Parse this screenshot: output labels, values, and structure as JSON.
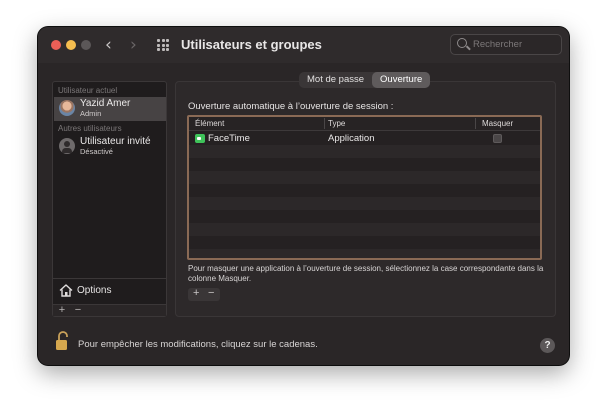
{
  "window": {
    "title": "Utilisateurs et groupes",
    "back_glyph": "‹",
    "forward_glyph": "›",
    "search_placeholder": "Rechercher"
  },
  "sidebar": {
    "current_section": "Utilisateur actuel",
    "current_user": {
      "name": "Yazid Amer",
      "role": "Admin"
    },
    "other_section": "Autres utilisateurs",
    "guest_user": {
      "name": "Utilisateur invité",
      "status": "Désactivé"
    },
    "options_label": "Options",
    "add_glyph": "+",
    "remove_glyph": "−"
  },
  "tabs": [
    {
      "label": "Mot de passe",
      "active": false
    },
    {
      "label": "Ouverture",
      "active": true
    }
  ],
  "login_items": {
    "heading": "Ouverture automatique à l’ouverture de session :",
    "columns": [
      "Élément",
      "Type",
      "Masquer"
    ],
    "rows": [
      {
        "element": "FaceTime",
        "type": "Application",
        "hide": false,
        "icon": "facetime-icon"
      }
    ],
    "help_text": "Pour masquer une application à l’ouverture de session, sélectionnez la case correspondante dans la colonne Masquer.",
    "add_glyph": "+",
    "remove_glyph": "−"
  },
  "footer": {
    "lock_text": "Pour empêcher les modifications, cliquez sur le cadenas.",
    "help_glyph": "?"
  },
  "colors": {
    "window_bg": "#2a2627",
    "selection": "#474344",
    "table_border": "#8a6a55",
    "facetime_green": "#3fc35a"
  }
}
